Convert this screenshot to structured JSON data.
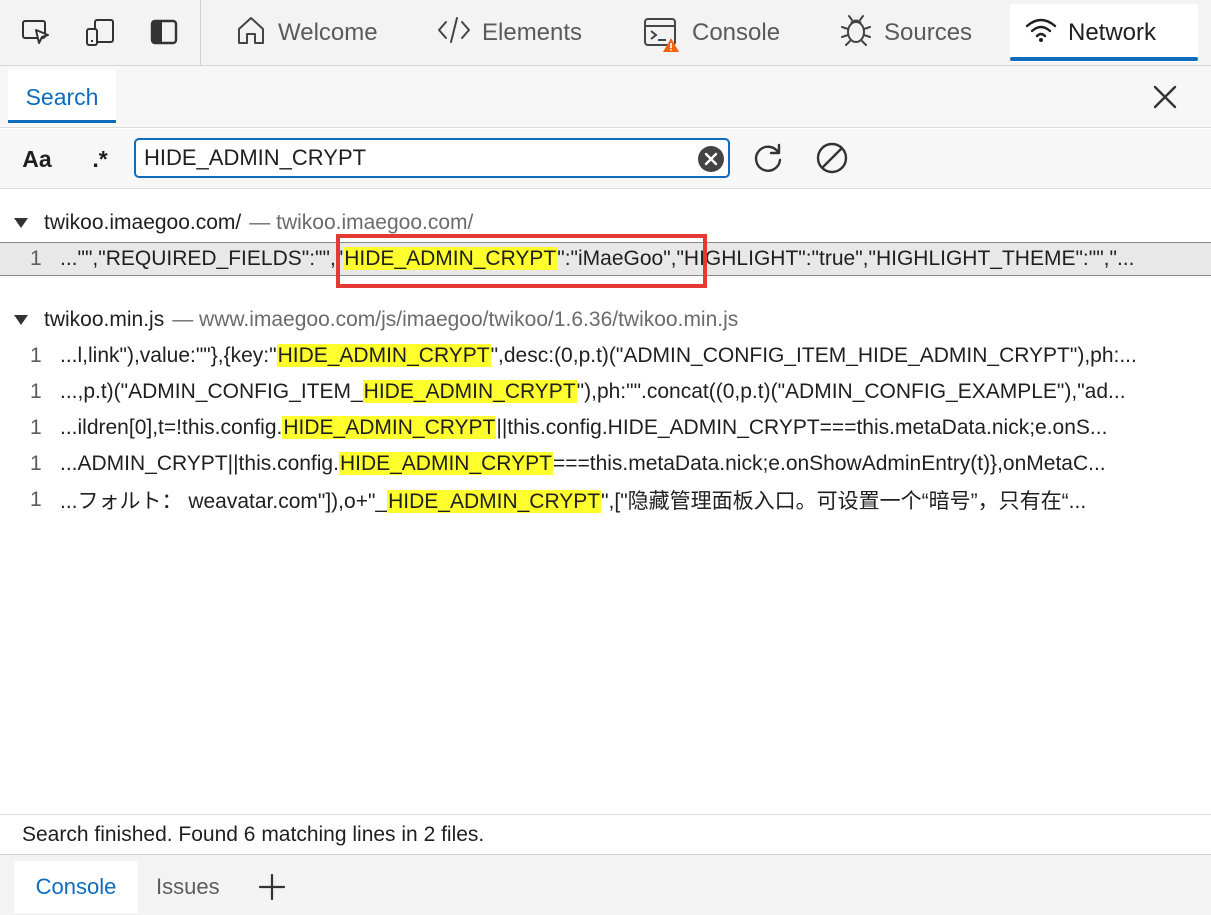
{
  "toolbar": {
    "icons": [
      "inspect-icon",
      "device-emulation-icon",
      "dock-icon"
    ],
    "tabs": [
      {
        "label": "Welcome",
        "icon": "home-icon"
      },
      {
        "label": "Elements",
        "icon": "code-icon"
      },
      {
        "label": "Console",
        "icon": "console-icon"
      },
      {
        "label": "Sources",
        "icon": "bug-icon"
      },
      {
        "label": "Network",
        "icon": "wifi-icon"
      }
    ],
    "active_tab": "Network",
    "accent": "#0f6cbd"
  },
  "panel": {
    "tab_label": "Search",
    "case_label": "Aa",
    "regex_label": ".*"
  },
  "search": {
    "value": "HIDE_ADMIN_CRYPT"
  },
  "results": {
    "files": [
      {
        "name": "twikoo.imaegoo.com/",
        "path": "twikoo.imaegoo.com/",
        "matches": [
          {
            "line": "1",
            "before": "...\"\",\"REQUIRED_FIELDS\":\"\",\"",
            "hit": "HIDE_ADMIN_CRYPT",
            "after": "\":\"iMaeGoo\",\"HIGHLIGHT\":\"true\",\"HIGHLIGHT_THEME\":\"\",\"..."
          }
        ]
      },
      {
        "name": "twikoo.min.js",
        "path": "www.imaegoo.com/js/imaegoo/twikoo/1.6.36/twikoo.min.js",
        "matches": [
          {
            "line": "1",
            "before": "...l,link\"),value:\"\"},{key:\"",
            "hit": "HIDE_ADMIN_CRYPT",
            "after": "\",desc:(0,p.t)(\"ADMIN_CONFIG_ITEM_HIDE_ADMIN_CRYPT\"),ph:..."
          },
          {
            "line": "1",
            "before": "...,p.t)(\"ADMIN_CONFIG_ITEM_",
            "hit": "HIDE_ADMIN_CRYPT",
            "after": "\"),ph:\"\".concat((0,p.t)(\"ADMIN_CONFIG_EXAMPLE\"),\"ad..."
          },
          {
            "line": "1",
            "before": "...ildren[0],t=!this.config.",
            "hit": "HIDE_ADMIN_CRYPT",
            "after": "||this.config.HIDE_ADMIN_CRYPT===this.metaData.nick;e.onS..."
          },
          {
            "line": "1",
            "before": "...ADMIN_CRYPT||this.config.",
            "hit": "HIDE_ADMIN_CRYPT",
            "after": "===this.metaData.nick;e.onShowAdminEntry(t)},onMetaC..."
          },
          {
            "line": "1",
            "before": "...フォルト： weavatar.com\"]),o+\"_",
            "hit": "HIDE_ADMIN_CRYPT",
            "after": "\",[\"隐藏管理面板入口。可设置一个“暗号”，只有在“..."
          }
        ]
      }
    ],
    "highlight_color": "#ffff2e"
  },
  "status": {
    "text": "Search finished.  Found 6 matching lines in 2 files."
  },
  "drawer": {
    "tabs": [
      "Console",
      "Issues"
    ],
    "active_tab": "Console",
    "add_icon": "plus-icon"
  }
}
